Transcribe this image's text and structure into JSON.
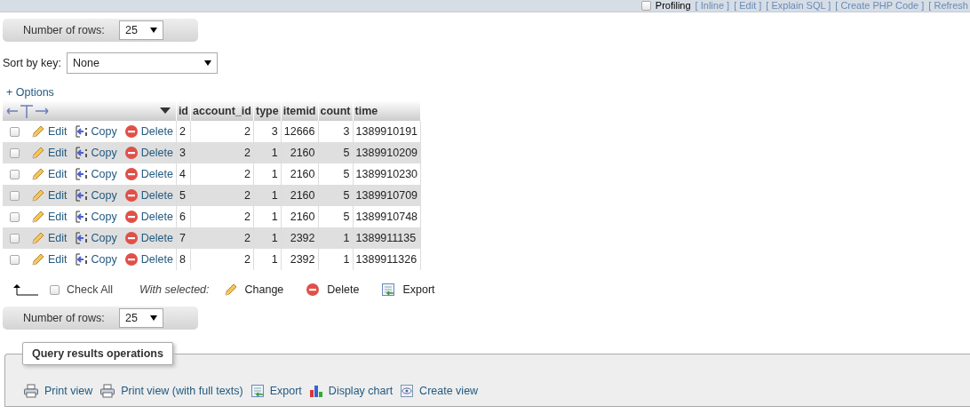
{
  "top_bar": {
    "profiling": {
      "label": "Profiling",
      "checked": false
    },
    "links": [
      "[ Inline ]",
      "[ Edit ]",
      "[ Explain SQL ]",
      "[ Create PHP Code ]",
      "[ Refresh"
    ]
  },
  "rows_top": {
    "label": "Number of rows:",
    "value": "25"
  },
  "sort": {
    "label": "Sort by key:",
    "value": "None"
  },
  "options_link": "+ Options",
  "table": {
    "columns": [
      "id",
      "account_id",
      "type",
      "itemid",
      "count",
      "time"
    ],
    "rows": [
      {
        "checked": false,
        "actions": [
          "Edit",
          "Copy",
          "Delete"
        ],
        "cells": [
          "2",
          "2",
          "3",
          "12666",
          "3",
          "1389910191"
        ]
      },
      {
        "checked": false,
        "actions": [
          "Edit",
          "Copy",
          "Delete"
        ],
        "cells": [
          "3",
          "2",
          "1",
          "2160",
          "5",
          "1389910209"
        ]
      },
      {
        "checked": false,
        "actions": [
          "Edit",
          "Copy",
          "Delete"
        ],
        "cells": [
          "4",
          "2",
          "1",
          "2160",
          "5",
          "1389910230"
        ]
      },
      {
        "checked": false,
        "actions": [
          "Edit",
          "Copy",
          "Delete"
        ],
        "cells": [
          "5",
          "2",
          "1",
          "2160",
          "5",
          "1389910709"
        ]
      },
      {
        "checked": false,
        "actions": [
          "Edit",
          "Copy",
          "Delete"
        ],
        "cells": [
          "6",
          "2",
          "1",
          "2160",
          "5",
          "1389910748"
        ]
      },
      {
        "checked": false,
        "actions": [
          "Edit",
          "Copy",
          "Delete"
        ],
        "cells": [
          "7",
          "2",
          "1",
          "2392",
          "1",
          "1389911135"
        ]
      },
      {
        "checked": false,
        "actions": [
          "Edit",
          "Copy",
          "Delete"
        ],
        "cells": [
          "8",
          "2",
          "1",
          "2392",
          "1",
          "1389911326"
        ]
      }
    ]
  },
  "bulk": {
    "check_all": {
      "label": "Check All",
      "checked": false
    },
    "with_selected": "With selected:",
    "actions": [
      {
        "kind": "edit",
        "label": "Change"
      },
      {
        "kind": "delete",
        "label": "Delete"
      },
      {
        "kind": "export",
        "label": "Export"
      }
    ]
  },
  "rows_bottom": {
    "label": "Number of rows:",
    "value": "25"
  },
  "operations": {
    "title": "Query results operations",
    "links": [
      {
        "kind": "print",
        "label": "Print view"
      },
      {
        "kind": "print",
        "label": "Print view (with full texts)"
      },
      {
        "kind": "export",
        "label": "Export"
      },
      {
        "kind": "chart",
        "label": "Display chart"
      },
      {
        "kind": "view",
        "label": "Create view"
      }
    ]
  }
}
